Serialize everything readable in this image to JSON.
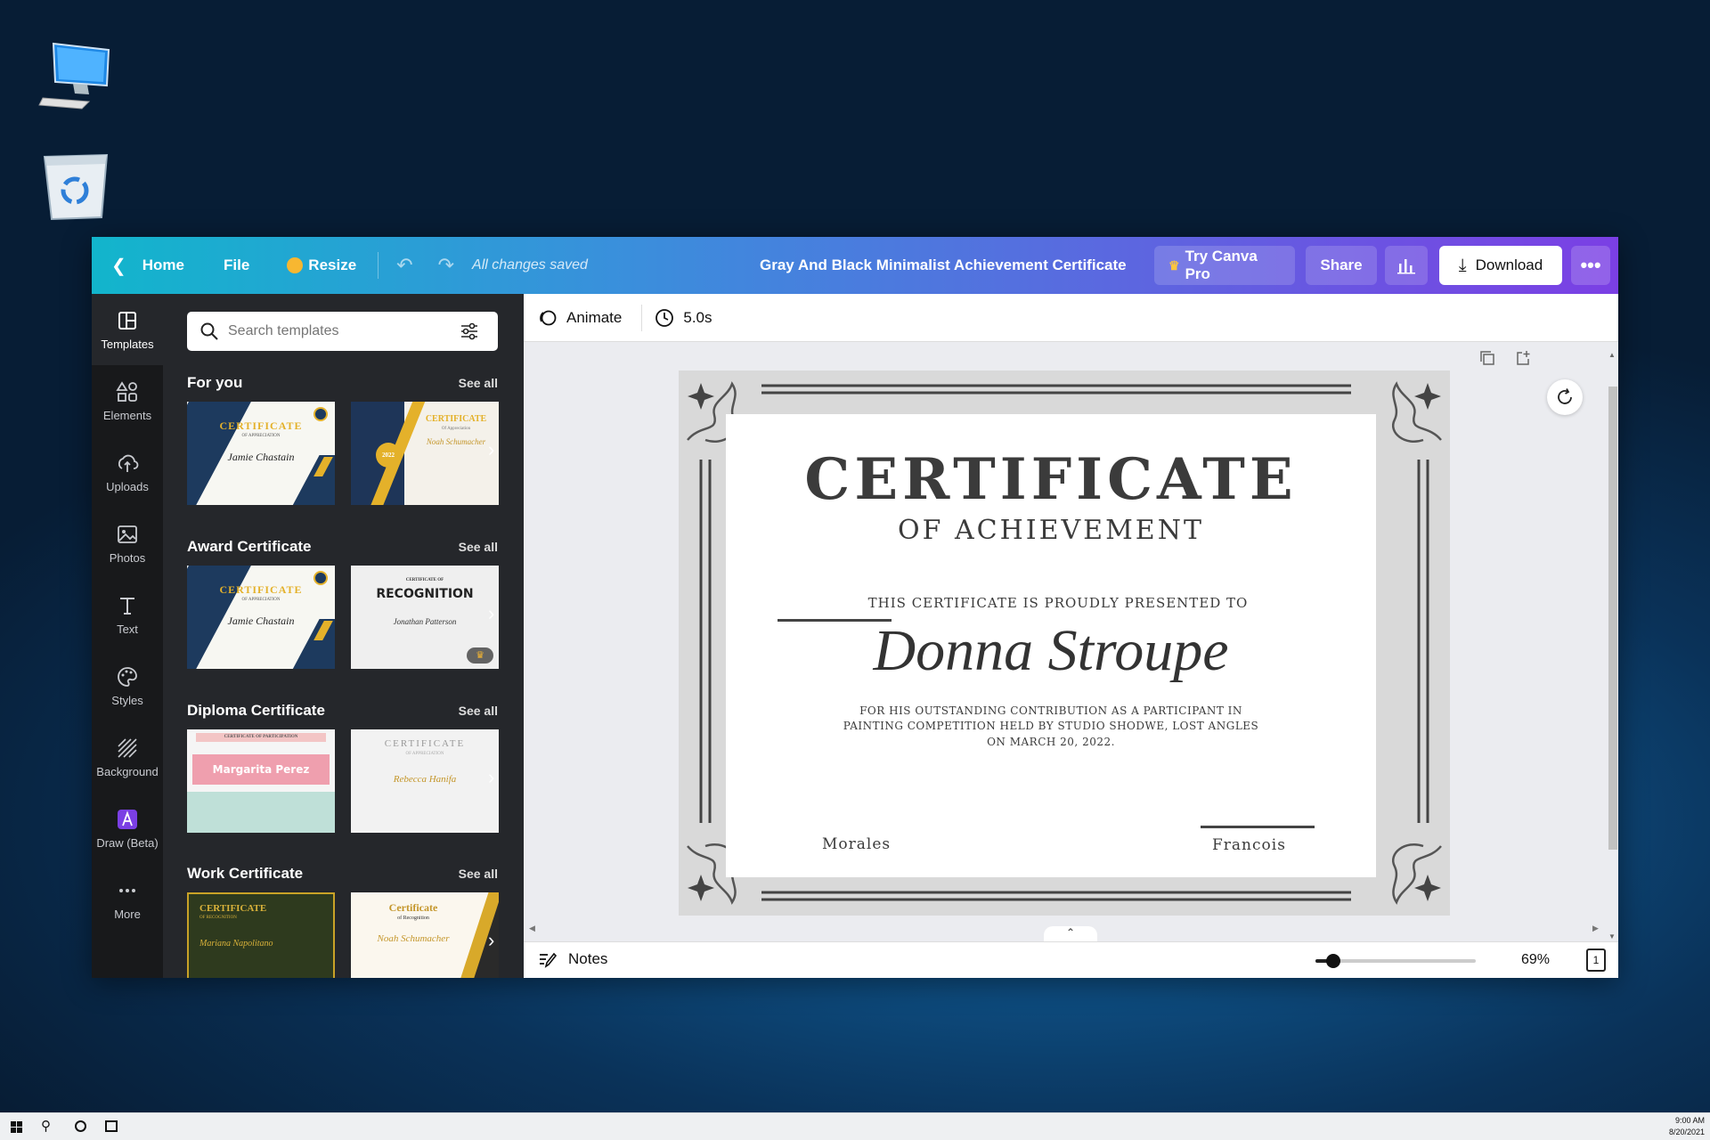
{
  "topbar": {
    "home": "Home",
    "file": "File",
    "resize": "Resize",
    "saved_status": "All changes saved",
    "doc_title": "Gray And Black Minimalist Achievement Certificate",
    "try_pro": "Try Canva Pro",
    "share": "Share",
    "download": "Download"
  },
  "rail": {
    "items": [
      {
        "label": "Templates",
        "icon": "templates-icon"
      },
      {
        "label": "Elements",
        "icon": "elements-icon"
      },
      {
        "label": "Uploads",
        "icon": "uploads-icon"
      },
      {
        "label": "Photos",
        "icon": "photos-icon"
      },
      {
        "label": "Text",
        "icon": "text-icon"
      },
      {
        "label": "Styles",
        "icon": "styles-icon"
      },
      {
        "label": "Background",
        "icon": "background-icon"
      },
      {
        "label": "Draw (Beta)",
        "icon": "draw-icon"
      },
      {
        "label": "More",
        "icon": "more-icon"
      }
    ]
  },
  "panel": {
    "search_placeholder": "Search templates",
    "see_all": "See all",
    "sections": [
      {
        "title": "For you"
      },
      {
        "title": "Award Certificate"
      },
      {
        "title": "Diploma Certificate"
      },
      {
        "title": "Work Certificate"
      }
    ],
    "thumbs": {
      "t1": {
        "title": "CERTIFICATE",
        "sub": "OF APPRECIATION",
        "name": "Jamie Chastain"
      },
      "t2": {
        "title": "CERTIFICATE",
        "sub": "Of Appreciation",
        "name": "Noah Schumacher",
        "badge": "2022"
      },
      "t3": {
        "title": "CERTIFICATE",
        "sub": "OF APPRECIATION",
        "name": "Jamie Chastain"
      },
      "t4": {
        "title": "RECOGNITION",
        "sub": "CERTIFICATE OF",
        "name": "Jonathan Patterson"
      },
      "t5": {
        "title": "CERTIFICATE OF PARTICIPATION",
        "name": "Margarita Perez"
      },
      "t6": {
        "title": "CERTIFICATE",
        "sub": "OF APPRECIATION",
        "name": "Rebecca Hanifa"
      },
      "t7": {
        "title": "CERTIFICATE",
        "sub": "OF RECOGNITION",
        "name": "Mariana Napolitano"
      },
      "t8": {
        "title": "Certificate",
        "sub": "of Recognition",
        "name": "Noah Schumacher"
      }
    }
  },
  "canvas_toolbar": {
    "animate": "Animate",
    "duration": "5.0s"
  },
  "certificate": {
    "title": "CERTIFICATE",
    "subtitle": "OF ACHIEVEMENT",
    "presented": "THIS CERTIFICATE IS PROUDLY PRESENTED TO",
    "recipient": "Donna Stroupe",
    "body_line1": "FOR HIS OUTSTANDING CONTRIBUTION AS A PARTICIPANT IN",
    "body_line2": "PAINTING COMPETITION HELD BY STUDIO SHODWE, LOST ANGLES",
    "body_line3": "ON MARCH 20, 2022.",
    "sign_left": "Morales",
    "sign_right": "Francois"
  },
  "bottom_bar": {
    "notes": "Notes",
    "zoom": "69%",
    "zoom_fraction": 0.11,
    "page_count": "1"
  },
  "taskbar": {
    "time": "9:00 AM",
    "date": "8/20/2021"
  },
  "colors": {
    "gradient_start": "#12b5cc",
    "gradient_end": "#7b3fe4",
    "rail_bg": "#18191b",
    "panel_bg": "#25272b"
  }
}
